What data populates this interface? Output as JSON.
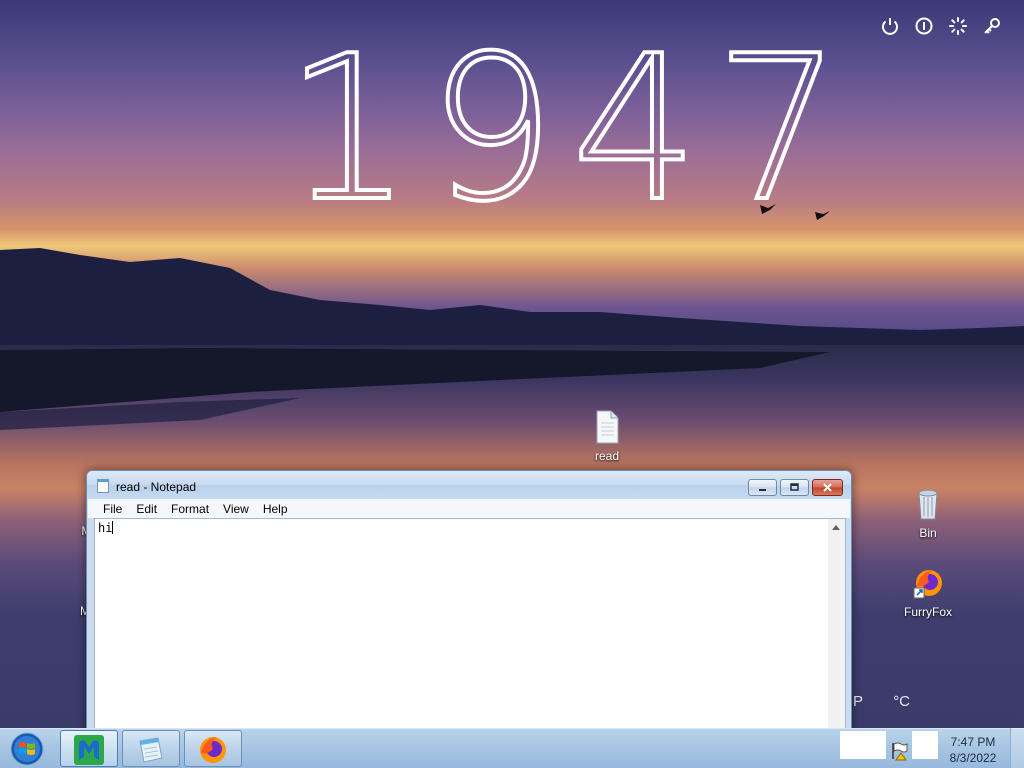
{
  "lockscreen": {
    "clock_digits": "1947",
    "top_icons": [
      "power-icon",
      "info-icon",
      "loading-icon",
      "key-icon"
    ],
    "weather_fragment": [
      "P",
      "°C"
    ]
  },
  "desktop": {
    "icons": [
      {
        "name": "file-icon",
        "label": "read"
      },
      {
        "name": "recycle-bin-icon",
        "label": "Bin"
      },
      {
        "name": "firefox-icon",
        "label": "FurryFox"
      },
      {
        "name": "partial-icon-1",
        "label": "Ma"
      },
      {
        "name": "partial-icon-2",
        "label": "M"
      }
    ]
  },
  "notepad": {
    "title": "read - Notepad",
    "menu": [
      "File",
      "Edit",
      "Format",
      "View",
      "Help"
    ],
    "content": "hi"
  },
  "taskbar": {
    "pinned": [
      {
        "name": "malwarebytes-icon",
        "active": true
      },
      {
        "name": "notepad-icon",
        "active": false
      },
      {
        "name": "firefox-icon",
        "active": false
      }
    ],
    "time": "7:47 PM",
    "date": "8/3/2022"
  },
  "colors": {
    "taskbar": "#a8c6e3",
    "titlebar": "#c6d9ef",
    "close_button": "#c2422b"
  }
}
